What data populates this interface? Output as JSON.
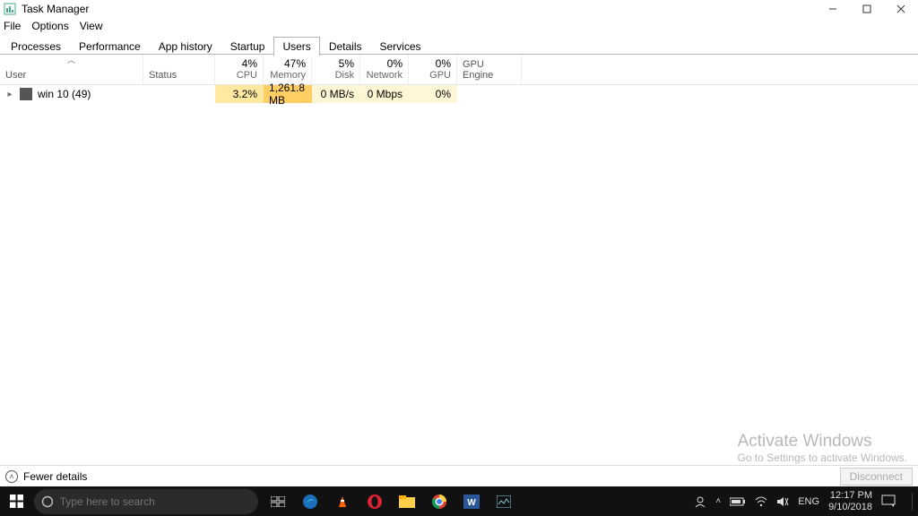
{
  "window": {
    "title": "Task Manager",
    "menu": [
      "File",
      "Options",
      "View"
    ],
    "tabs": [
      "Processes",
      "Performance",
      "App history",
      "Startup",
      "Users",
      "Details",
      "Services"
    ],
    "active_tab": "Users"
  },
  "columns": {
    "user": "User",
    "status": "Status",
    "cpu": {
      "pct": "4%",
      "label": "CPU"
    },
    "memory": {
      "pct": "47%",
      "label": "Memory"
    },
    "disk": {
      "pct": "5%",
      "label": "Disk"
    },
    "network": {
      "pct": "0%",
      "label": "Network"
    },
    "gpu": {
      "pct": "0%",
      "label": "GPU"
    },
    "gpu_engine": "GPU Engine"
  },
  "rows": [
    {
      "user": "win 10 (49)",
      "status": "",
      "cpu": "3.2%",
      "memory": "1,261.8 MB",
      "disk": "0 MB/s",
      "network": "0 Mbps",
      "gpu": "0%",
      "gpu_engine": ""
    }
  ],
  "footer": {
    "fewer_details": "Fewer details",
    "disconnect": "Disconnect"
  },
  "watermark": {
    "line1": "Activate Windows",
    "line2": "Go to Settings to activate Windows."
  },
  "taskbar": {
    "search_placeholder": "Type here to search",
    "lang": "ENG",
    "time": "12:17 PM",
    "date": "9/10/2018"
  }
}
